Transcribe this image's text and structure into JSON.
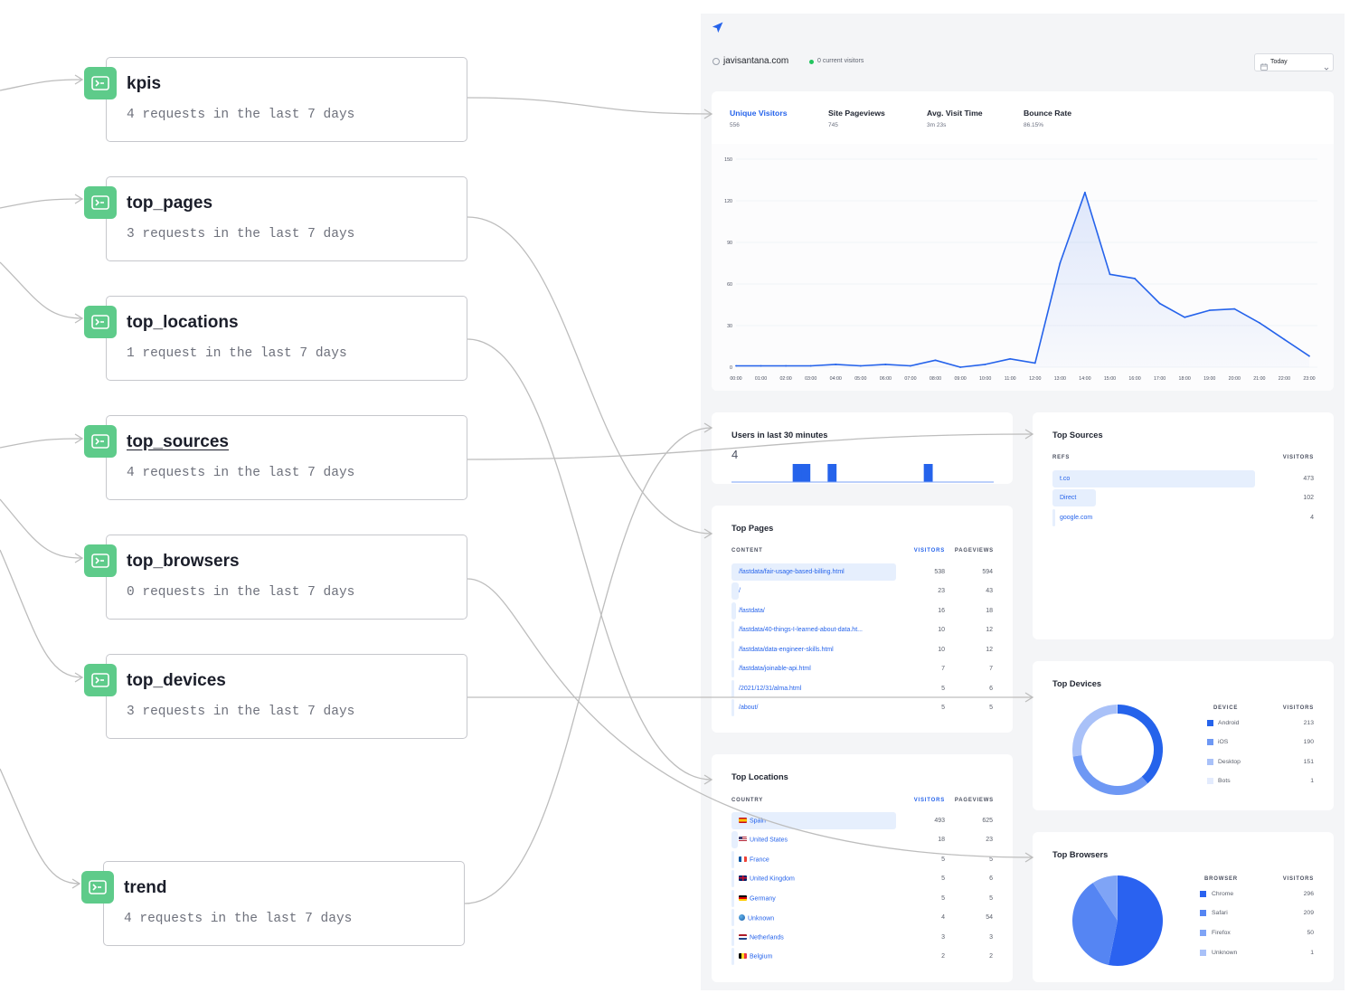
{
  "endpoints": [
    {
      "name": "kpis",
      "requests": "4 requests in the last 7 days"
    },
    {
      "name": "top_pages",
      "requests": "3 requests in the last 7 days"
    },
    {
      "name": "top_locations",
      "requests": "1 request in the last 7 days"
    },
    {
      "name": "top_sources",
      "requests": "4 requests in the last 7 days"
    },
    {
      "name": "top_browsers",
      "requests": "0 requests in the last 7 days"
    },
    {
      "name": "top_devices",
      "requests": "3 requests in the last 7 days"
    },
    {
      "name": "trend",
      "requests": "4 requests in the last 7 days"
    }
  ],
  "dashboard": {
    "site": "javisantana.com",
    "current_visitors": "0 current visitors",
    "date_filter": {
      "selected": "Today"
    },
    "colors": {
      "accent": "#2563eb",
      "endpoint_icon": "#5ecb8a",
      "live_dot": "#22c55e",
      "row_bar": "#e6effd"
    },
    "kpis": [
      {
        "label": "Unique Visitors",
        "value": "556",
        "active": true
      },
      {
        "label": "Site Pageviews",
        "value": "745",
        "active": false
      },
      {
        "label": "Avg. Visit Time",
        "value": "3m 23s",
        "active": false
      },
      {
        "label": "Bounce Rate",
        "value": "86.15%",
        "active": false
      }
    ],
    "users_last_30": {
      "title": "Users in last 30 minutes",
      "count": "4"
    },
    "top_pages": {
      "title": "Top Pages",
      "columns": [
        "CONTENT",
        "VISITORS",
        "PAGEVIEWS"
      ],
      "rows": [
        {
          "label": "/fastdata/fair-usage-based-billing.html",
          "visitors": 538,
          "pageviews": 594
        },
        {
          "label": "/",
          "visitors": 23,
          "pageviews": 43
        },
        {
          "label": "/fastdata/",
          "visitors": 16,
          "pageviews": 18
        },
        {
          "label": "/fastdata/40-things-I-learned-about-data.ht...",
          "visitors": 10,
          "pageviews": 12
        },
        {
          "label": "/fastdata/data-engineer-skills.html",
          "visitors": 10,
          "pageviews": 12
        },
        {
          "label": "/fastdata/joinable-api.html",
          "visitors": 7,
          "pageviews": 7
        },
        {
          "label": "/2021/12/31/alma.html",
          "visitors": 5,
          "pageviews": 6
        },
        {
          "label": "/about/",
          "visitors": 5,
          "pageviews": 5
        }
      ]
    },
    "top_locations": {
      "title": "Top Locations",
      "columns": [
        "COUNTRY",
        "VISITORS",
        "PAGEVIEWS"
      ],
      "rows": [
        {
          "flag": "es",
          "label": "Spain",
          "visitors": 493,
          "pageviews": 625
        },
        {
          "flag": "us",
          "label": "United States",
          "visitors": 18,
          "pageviews": 23
        },
        {
          "flag": "fr",
          "label": "France",
          "visitors": 5,
          "pageviews": 5
        },
        {
          "flag": "gb",
          "label": "United Kingdom",
          "visitors": 5,
          "pageviews": 6
        },
        {
          "flag": "de",
          "label": "Germany",
          "visitors": 5,
          "pageviews": 5
        },
        {
          "flag": "globe",
          "label": "Unknown",
          "visitors": 4,
          "pageviews": 54
        },
        {
          "flag": "nl",
          "label": "Netherlands",
          "visitors": 3,
          "pageviews": 3
        },
        {
          "flag": "be",
          "label": "Belgium",
          "visitors": 2,
          "pageviews": 2
        }
      ]
    },
    "top_sources": {
      "title": "Top Sources",
      "columns": [
        "REFS",
        "VISITORS"
      ],
      "rows": [
        {
          "label": "t.co",
          "visitors": 473
        },
        {
          "label": "Direct",
          "visitors": 102
        },
        {
          "label": "google.com",
          "visitors": 4
        }
      ]
    },
    "top_devices": {
      "title": "Top Devices",
      "columns": [
        "DEVICE",
        "VISITORS"
      ]
    },
    "top_browsers": {
      "title": "Top Browsers",
      "columns": [
        "BROWSER",
        "VISITORS"
      ]
    }
  },
  "chart_data": [
    {
      "type": "area",
      "title": "Unique Visitors",
      "x": [
        "00:00",
        "01:00",
        "02:00",
        "03:00",
        "04:00",
        "05:00",
        "06:00",
        "07:00",
        "08:00",
        "09:00",
        "10:00",
        "11:00",
        "12:00",
        "13:00",
        "14:00",
        "15:00",
        "16:00",
        "17:00",
        "18:00",
        "19:00",
        "20:00",
        "21:00",
        "22:00",
        "23:00"
      ],
      "values": [
        1,
        1,
        1,
        1,
        2,
        1,
        2,
        1,
        5,
        0,
        2,
        6,
        3,
        75,
        126,
        67,
        64,
        46,
        36,
        41,
        42,
        32,
        20,
        8
      ],
      "xlabel": "",
      "ylabel": "",
      "ylim": [
        0,
        150
      ],
      "yticks": [
        0,
        30,
        60,
        90,
        120,
        150
      ],
      "grid": true,
      "color": "#2563eb"
    },
    {
      "type": "bar",
      "title": "Users in last 30 minutes",
      "total": 4,
      "values": [
        0,
        0,
        0,
        0,
        0,
        0,
        0,
        1,
        1,
        0,
        0,
        1,
        0,
        0,
        0,
        0,
        0,
        0,
        0,
        0,
        0,
        0,
        1,
        0,
        0,
        0,
        0,
        0,
        0,
        0
      ],
      "color": "#2563eb"
    },
    {
      "type": "pie",
      "donut": true,
      "title": "Top Devices",
      "categories": [
        "Android",
        "iOS",
        "Desktop",
        "Bots"
      ],
      "values": [
        213,
        190,
        151,
        1
      ],
      "colors": [
        "#2563eb",
        "#6e98f4",
        "#a9c1f8",
        "#e3ebfd"
      ],
      "legend": "right"
    },
    {
      "type": "pie",
      "title": "Top Browsers",
      "categories": [
        "Chrome",
        "Safari",
        "Firefox",
        "Unknown"
      ],
      "values": [
        296,
        209,
        50,
        1
      ],
      "colors": [
        "#2a62f0",
        "#5585f3",
        "#7fa4f6",
        "#a9c1f8"
      ],
      "legend": "right"
    }
  ]
}
